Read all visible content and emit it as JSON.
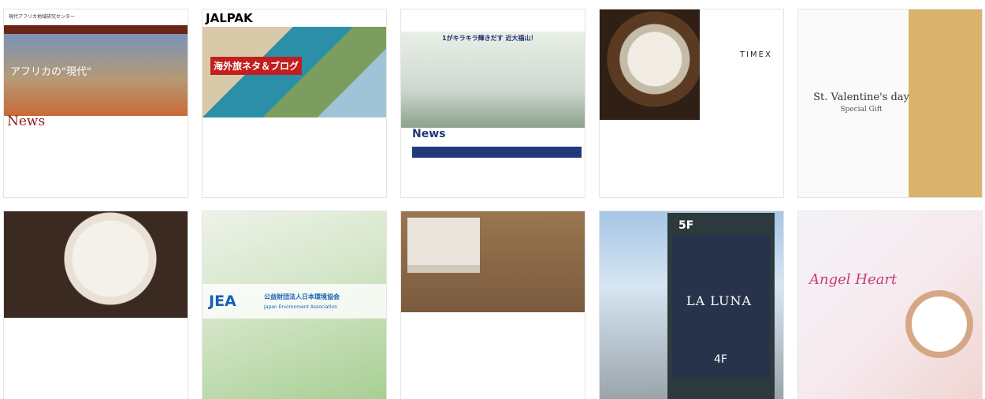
{
  "tiles": [
    {
      "id": "t1",
      "name": "african-studies-site-tile",
      "title": "現代アフリカ地域研究センター",
      "hero_text": "アフリカの\"現代\"",
      "section": "News"
    },
    {
      "id": "t2",
      "name": "jalpak-site-tile",
      "logo": "JALPAK",
      "banner": "海外旅ネタ＆ブログ"
    },
    {
      "id": "t3",
      "name": "kindai-fukuyama-site-tile",
      "headline": "1がキラキラ輝きだす 近大福山！",
      "section": "News"
    },
    {
      "id": "t4",
      "name": "timex-site-tile",
      "brand": "TIMEX"
    },
    {
      "id": "t5",
      "name": "valentine-site-tile",
      "title": "St. Valentine's day",
      "subtitle": "Special Gift"
    },
    {
      "id": "t6",
      "name": "restaurant-site-tile"
    },
    {
      "id": "t7",
      "name": "jea-site-tile",
      "logo": "JEA",
      "org_jp": "公益財団法人日本環境協会",
      "org_en": "Japan Environment Association"
    },
    {
      "id": "t8",
      "name": "corporate-book-site-tile"
    },
    {
      "id": "t9",
      "name": "la-luna-site-tile",
      "floor_top": "5F",
      "brand": "LA LUNA",
      "floor_bottom": "4F"
    },
    {
      "id": "t10",
      "name": "angel-heart-site-tile",
      "brand": "Angel Heart"
    }
  ],
  "colors": {
    "brand_red": "#8b1d1d",
    "jea_blue": "#1a5fb4",
    "angel_pink": "#c83a79"
  }
}
